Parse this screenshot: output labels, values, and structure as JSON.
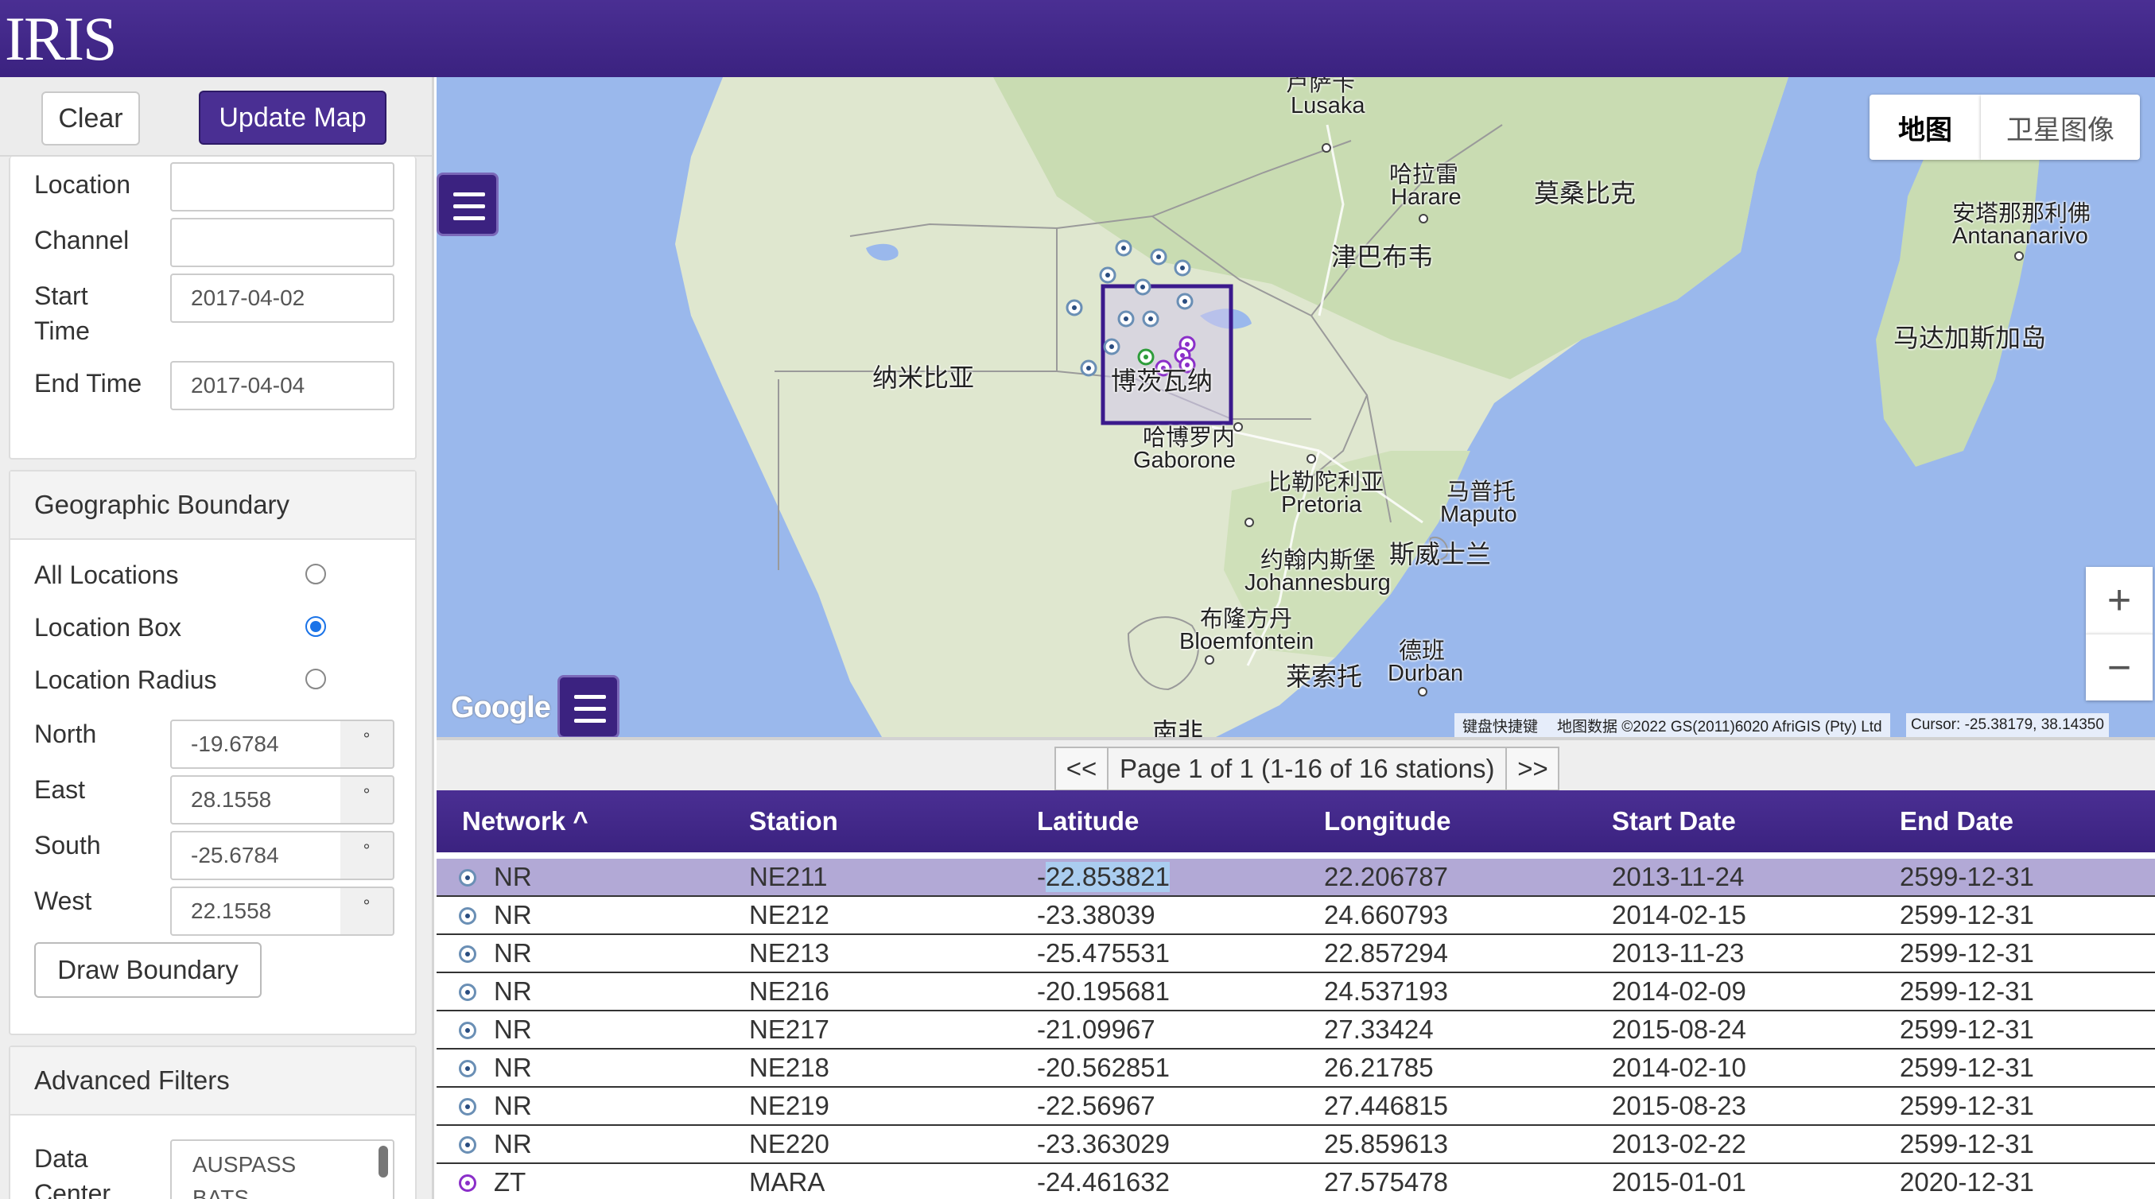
{
  "header": {
    "logo_text": "IRIS"
  },
  "toolbar": {
    "clear_label": "Clear",
    "update_label": "Update Map"
  },
  "filters": {
    "location_label": "Location",
    "location_value": "",
    "channel_label": "Channel",
    "channel_value": "",
    "start_label": "Start\nTime",
    "start_value": "2017-04-02",
    "end_label": "End Time",
    "end_value": "2017-04-04"
  },
  "geo": {
    "title": "Geographic Boundary",
    "options": [
      {
        "label": "All Locations",
        "selected": false
      },
      {
        "label": "Location Box",
        "selected": true
      },
      {
        "label": "Location Radius",
        "selected": false
      }
    ],
    "fields": [
      {
        "label": "North",
        "value": "-19.6784",
        "unit": "°"
      },
      {
        "label": "East",
        "value": "28.1558",
        "unit": "°"
      },
      {
        "label": "South",
        "value": "-25.6784",
        "unit": "°"
      },
      {
        "label": "West",
        "value": "22.1558",
        "unit": "°"
      }
    ],
    "draw_label": "Draw Boundary"
  },
  "advanced": {
    "title": "Advanced Filters",
    "datacenter_label": "Data\nCenter",
    "datacenter_options": [
      "AUSPASS",
      "BATS"
    ]
  },
  "map": {
    "maptype_map": "地图",
    "maptype_sat": "卫星图像",
    "zoom_in": "+",
    "zoom_out": "−",
    "google": "Google",
    "shortcuts": "键盘快捷键",
    "attribution": "地图数据 ©2022 GS(2011)6020 AfriGIS (Pty) Ltd",
    "cursor": "Cursor: -25.38179, 38.14350",
    "labels": {
      "lusaka_zh": "卢萨卡",
      "lusaka": "Lusaka",
      "harare_zh": "哈拉雷",
      "harare": "Harare",
      "mozambique": "莫桑比克",
      "zimbabwe": "津巴布韦",
      "antananarivo_zh": "安塔那那利佛",
      "antananarivo": "Antananarivo",
      "madagascar": "马达加斯加岛",
      "namibia": "纳米比亚",
      "botswana": "博茨瓦纳",
      "gaborone_zh": "哈博罗内",
      "gaborone": "Gaborone",
      "pretoria_zh": "比勒陀利亚",
      "pretoria": "Pretoria",
      "maputo_zh": "马普托",
      "maputo": "Maputo",
      "johannesburg_zh": "约翰内斯堡",
      "johannesburg": "Johannesburg",
      "eswatini": "斯威士兰",
      "bloemfontein_zh": "布隆方丹",
      "bloemfontein": "Bloemfontein",
      "durban_zh": "德班",
      "durban": "Durban",
      "lesotho": "莱索托",
      "south_africa": "南非"
    }
  },
  "pager": {
    "prev": "<<",
    "text": "Page 1 of 1 (1-16 of 16 stations)",
    "next": ">>"
  },
  "table": {
    "headers": [
      "Network ^",
      "Station",
      "Latitude",
      "Longitude",
      "Start Date",
      "End Date"
    ],
    "rows": [
      {
        "network": "NR",
        "station": "NE211",
        "lat": "-22.853821",
        "lon": "22.206787",
        "start": "2013-11-24",
        "end": "2599-12-31"
      },
      {
        "network": "NR",
        "station": "NE212",
        "lat": "-23.38039",
        "lon": "24.660793",
        "start": "2014-02-15",
        "end": "2599-12-31"
      },
      {
        "network": "NR",
        "station": "NE213",
        "lat": "-25.475531",
        "lon": "22.857294",
        "start": "2013-11-23",
        "end": "2599-12-31"
      },
      {
        "network": "NR",
        "station": "NE216",
        "lat": "-20.195681",
        "lon": "24.537193",
        "start": "2014-02-09",
        "end": "2599-12-31"
      },
      {
        "network": "NR",
        "station": "NE217",
        "lat": "-21.09967",
        "lon": "27.33424",
        "start": "2015-08-24",
        "end": "2599-12-31"
      },
      {
        "network": "NR",
        "station": "NE218",
        "lat": "-20.562851",
        "lon": "26.21785",
        "start": "2014-02-10",
        "end": "2599-12-31"
      },
      {
        "network": "NR",
        "station": "NE219",
        "lat": "-22.56967",
        "lon": "27.446815",
        "start": "2015-08-23",
        "end": "2599-12-31"
      },
      {
        "network": "NR",
        "station": "NE220",
        "lat": "-23.363029",
        "lon": "25.859613",
        "start": "2013-02-22",
        "end": "2599-12-31"
      },
      {
        "network": "ZT",
        "station": "MARA",
        "lat": "-24.461632",
        "lon": "27.575478",
        "start": "2015-01-01",
        "end": "2020-12-31"
      }
    ]
  }
}
